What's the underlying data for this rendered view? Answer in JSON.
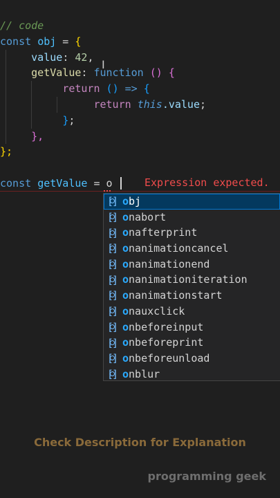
{
  "code": {
    "line1": "// code",
    "kw_const": "const",
    "obj_name": "obj",
    "eq": " = ",
    "open_brace": "{",
    "value_prop": "value",
    "colon": ": ",
    "num": "42",
    "comma": ",",
    "getValue_prop": "getValue",
    "function_kw": "function",
    "paren_open": "(",
    "paren_close": ")",
    "return_kw": "return",
    "arrow": " => ",
    "this_kw": "this",
    "dot_value": ".value",
    "semicolon": ";",
    "close_brace": "}",
    "closing_line_5": "},",
    "closing_last": "};",
    "getValue_var": "getValue",
    "typed": "o"
  },
  "error": {
    "message": "Expression expected."
  },
  "suggestions": {
    "highlight": "o",
    "items": [
      "bj",
      "nabort",
      "nafterprint",
      "nanimationcancel",
      "nanimationend",
      "nanimationiteration",
      "nanimationstart",
      "nauxclick",
      "nbeforeinput",
      "nbeforeprint",
      "nbeforeunload",
      "nblur"
    ],
    "selected_index": 0,
    "icon": "variable-icon"
  },
  "footer": {
    "note": "Check Description for Explanation",
    "brand": "programming geek"
  },
  "colors": {
    "background": "#1f1f1f",
    "error": "#f14c4c",
    "note": "#8a6a3a"
  }
}
